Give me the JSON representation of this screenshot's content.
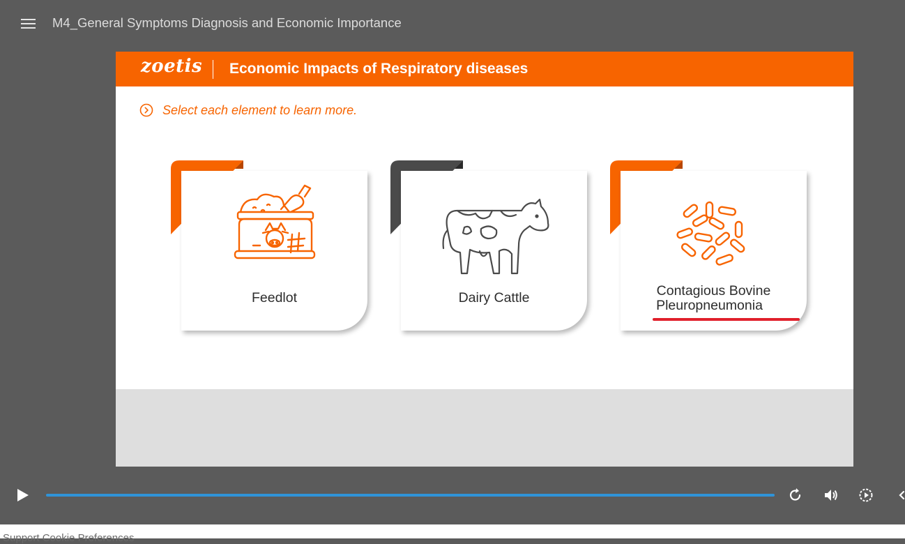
{
  "player": {
    "course_title": "M4_General Symptoms Diagnosis and Economic Importance",
    "progress_percent": 100
  },
  "slide": {
    "brand": "zoetis",
    "title": "Economic Impacts of Respiratory diseases",
    "instruction": "Select each element to learn more.",
    "cards": [
      {
        "label_lines": [
          "Feedlot"
        ],
        "icon": "feedlot-icon",
        "tab_color": "#f76400"
      },
      {
        "label_lines": [
          "Dairy Cattle"
        ],
        "icon": "cow-icon",
        "tab_color": "#4a4a4a"
      },
      {
        "label_lines": [
          "Contagious Bovine",
          "Pleuropneumonia"
        ],
        "icon": "bacteria-icon",
        "tab_color": "#f76400"
      }
    ]
  },
  "bottom_bar": {
    "text": "Support    Cookie Preferences"
  },
  "colors": {
    "accent": "#f76400",
    "progress": "#2f93d8",
    "underline": "#e0202b",
    "player_bg": "#5b5b5b"
  }
}
